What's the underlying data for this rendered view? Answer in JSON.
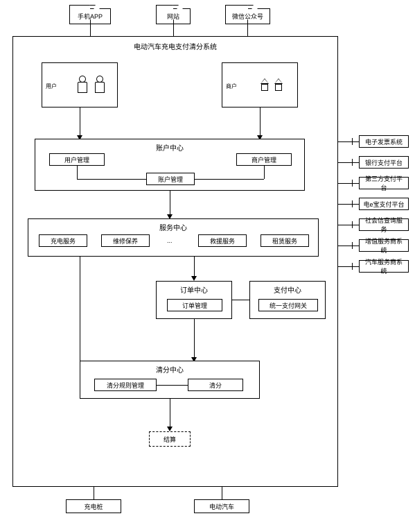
{
  "top_inputs": {
    "app": "手机APP",
    "website": "网站",
    "wechat": "微信公众号"
  },
  "system_title": "电动汽车充电支付清分系统",
  "user_box": {
    "label": "用户"
  },
  "merchant_box": {
    "label": "商户"
  },
  "account_center": {
    "title": "账户中心",
    "user_mgmt": "用户管理",
    "merchant_mgmt": "商户管理",
    "account_mgmt": "账户管理"
  },
  "service_center": {
    "title": "服务中心",
    "charging": "充电服务",
    "maintenance": "维修保养",
    "ellipsis": "...",
    "rescue": "救援服务",
    "rental": "租赁服务"
  },
  "order_center": {
    "title": "订单中心",
    "order_mgmt": "订单管理"
  },
  "payment_center": {
    "title": "支付中心",
    "gateway": "统一支付网关"
  },
  "clearing_center": {
    "title": "清分中心",
    "rule_mgmt": "清分规则管理",
    "clearing": "清分"
  },
  "settlement": "结算",
  "bottom_outputs": {
    "charging_pile": "充电桩",
    "ev": "电动汽车"
  },
  "external_systems": {
    "einvoice": "电子发票系统",
    "bank": "银行支付平台",
    "thirdparty": "第三方支付平台",
    "gold": "电e宝支付平台",
    "query": "社会信查询服务",
    "vas": "增值服务商系统",
    "auto": "汽车服务商系统"
  }
}
